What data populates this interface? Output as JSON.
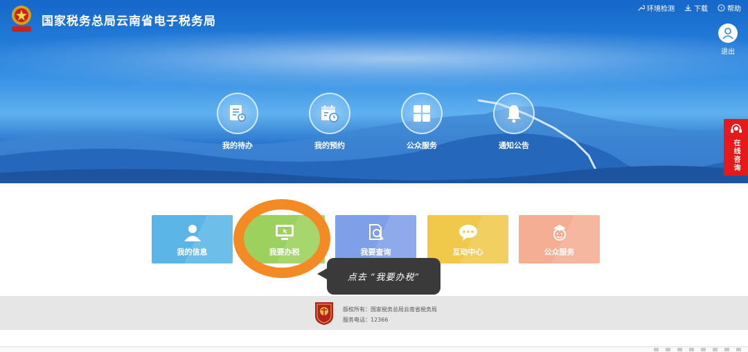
{
  "header": {
    "title": "国家税务总局云南省电子税务局",
    "emblem_icon": "tax-emblem-icon",
    "links": [
      {
        "label": "环境检测",
        "icon": "wrench-icon"
      },
      {
        "label": "下载",
        "icon": "download-icon"
      },
      {
        "label": "帮助",
        "icon": "help-icon"
      }
    ],
    "logout_label": "退出"
  },
  "quick_circles": [
    {
      "label": "我的待办",
      "icon": "todo-list-icon"
    },
    {
      "label": "我的预约",
      "icon": "calendar-icon"
    },
    {
      "label": "公众服务",
      "icon": "grid-icon"
    },
    {
      "label": "通知公告",
      "icon": "bell-icon"
    }
  ],
  "consult": {
    "label": "在线咨询",
    "icon": "headset-icon"
  },
  "tiles": [
    {
      "label": "我的信息",
      "icon": "user-icon",
      "color": "#5bb5e7"
    },
    {
      "label": "我要办税",
      "icon": "monitor-icon",
      "color": "#9bd15c"
    },
    {
      "label": "我要查询",
      "icon": "search-doc-icon",
      "color": "#7f9fe8"
    },
    {
      "label": "互动中心",
      "icon": "chat-icon",
      "color": "#f0c94a"
    },
    {
      "label": "公众服务",
      "icon": "face-icon",
      "color": "#f4ae93"
    }
  ],
  "tooltip": {
    "text": "点去 “我要办税”"
  },
  "highlight_color": "#f38a24",
  "footer": {
    "copyright": "版权所有：国家税务总局云南省税务局",
    "phone": "服务电话：12366"
  }
}
